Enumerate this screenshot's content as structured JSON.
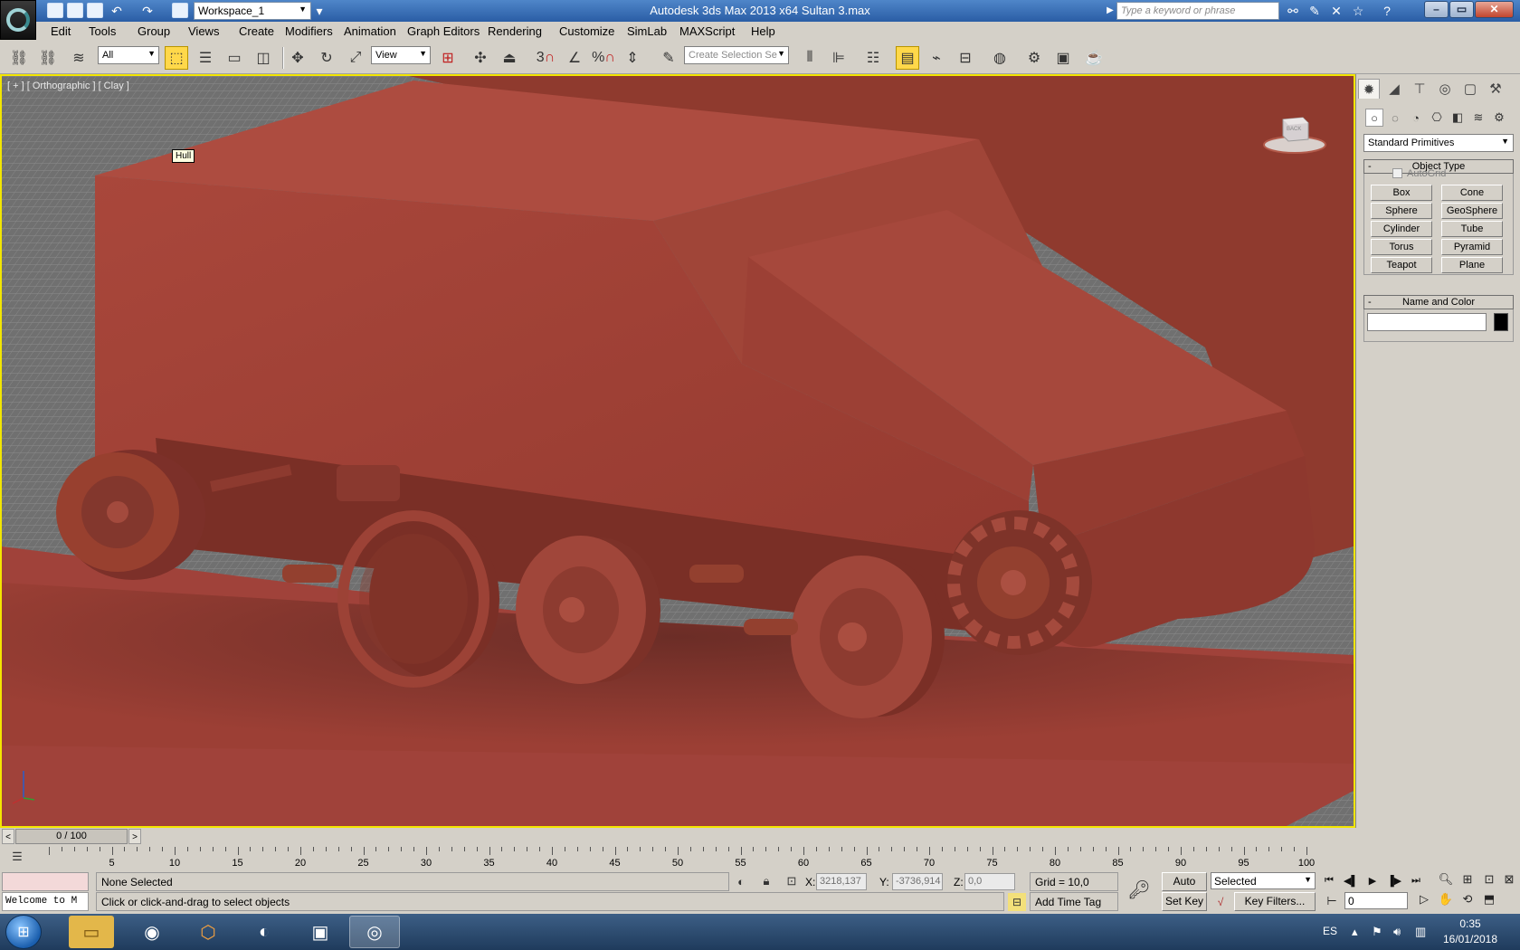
{
  "window": {
    "title": "Autodesk 3ds Max  2013 x64      Sultan 3.max",
    "workspace": "Workspace_1",
    "search_placeholder": "Type a keyword or phrase"
  },
  "menu": [
    "Edit",
    "Tools",
    "Group",
    "Views",
    "Create",
    "Modifiers",
    "Animation",
    "Graph Editors",
    "Rendering",
    "Customize",
    "SimLab",
    "MAXScript",
    "Help"
  ],
  "toolbar": {
    "selection_filter": "All",
    "ref_coord": "View",
    "named_selection_placeholder": "Create Selection Se",
    "snap_label": "3",
    "angle_snap_label": "%"
  },
  "viewport": {
    "label": "[ + ] [ Orthographic ] [ Clay ]",
    "tooltip": "Hull",
    "viewcube_face": "BACK",
    "colors": {
      "clay": "#a8463a",
      "active_border": "#f3e600"
    }
  },
  "command_panel": {
    "category": "Standard Primitives",
    "object_type_title": "Object Type",
    "autogrid_label": "AutoGrid",
    "buttons": [
      "Box",
      "Cone",
      "Sphere",
      "GeoSphere",
      "Cylinder",
      "Tube",
      "Torus",
      "Pyramid",
      "Teapot",
      "Plane"
    ],
    "name_color_title": "Name and Color",
    "name_value": ""
  },
  "time_slider": {
    "frame_display": "0 / 100",
    "prev": "<",
    "next": ">"
  },
  "trackbar": {
    "ticks": [
      0,
      5,
      10,
      15,
      20,
      25,
      30,
      35,
      40,
      45,
      50,
      55,
      60,
      65,
      70,
      75,
      80,
      85,
      90,
      95,
      100
    ]
  },
  "status": {
    "listener_text": "Welcome to M",
    "selection": "None Selected",
    "prompt": "Click or click-and-drag to select objects",
    "x_label": "X:",
    "x_value": "3218,137",
    "y_label": "Y:",
    "y_value": "-3736,914",
    "z_label": "Z:",
    "z_value": "0,0",
    "grid": "Grid = 10,0",
    "add_time_tag": "Add Time Tag",
    "auto_key": "Auto Key",
    "set_key": "Set Key",
    "key_mode": "Selected",
    "key_filters": "Key Filters...",
    "current_frame": "0"
  },
  "taskbar": {
    "language": "ES",
    "time": "0:35",
    "date": "16/01/2018"
  }
}
